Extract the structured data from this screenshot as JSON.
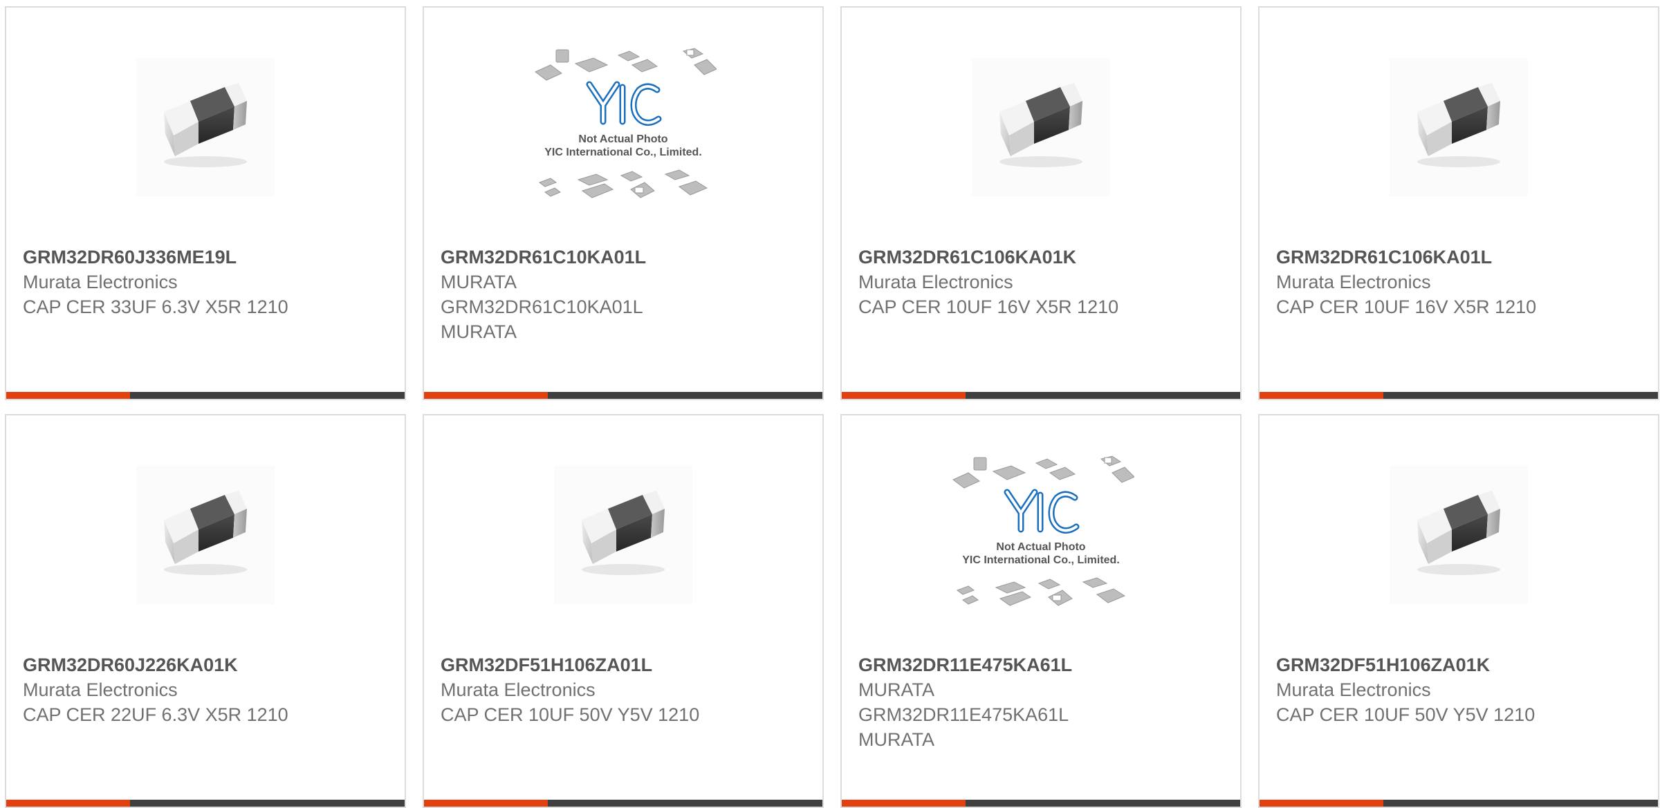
{
  "products": [
    {
      "part_number": "GRM32DR60J336ME19L",
      "lines": [
        "Murata Electronics",
        "CAP CER 33UF 6.3V X5R 1210"
      ],
      "photo": "capacitor-chip",
      "bar_progress": 0.31
    },
    {
      "part_number": "GRM32DR61C10KA01L",
      "lines": [
        "MURATA",
        "GRM32DR61C10KA01L",
        "MURATA"
      ],
      "photo": "placeholder-yic",
      "photo_text": {
        "notice": "Not Actual Photo",
        "company": "YIC International Co., Limited."
      },
      "bar_progress": 0.31
    },
    {
      "part_number": "GRM32DR61C106KA01K",
      "lines": [
        "Murata Electronics",
        "CAP CER 10UF 16V X5R 1210"
      ],
      "photo": "capacitor-chip",
      "bar_progress": 0.31
    },
    {
      "part_number": "GRM32DR61C106KA01L",
      "lines": [
        "Murata Electronics",
        "CAP CER 10UF 16V X5R 1210"
      ],
      "photo": "capacitor-chip",
      "bar_progress": 0.31
    },
    {
      "part_number": "GRM32DR60J226KA01K",
      "lines": [
        "Murata Electronics",
        "CAP CER 22UF 6.3V X5R 1210"
      ],
      "photo": "capacitor-chip",
      "bar_progress": 0.31
    },
    {
      "part_number": "GRM32DF51H106ZA01L",
      "lines": [
        "Murata Electronics",
        "CAP CER 10UF 50V Y5V 1210"
      ],
      "photo": "capacitor-chip",
      "bar_progress": 0.31
    },
    {
      "part_number": "GRM32DR11E475KA61L",
      "lines": [
        "MURATA",
        "GRM32DR11E475KA61L",
        "MURATA"
      ],
      "photo": "placeholder-yic",
      "photo_text": {
        "notice": "Not Actual Photo",
        "company": "YIC International Co., Limited."
      },
      "bar_progress": 0.31
    },
    {
      "part_number": "GRM32DF51H106ZA01K",
      "lines": [
        "Murata Electronics",
        "CAP CER 10UF 50V Y5V 1210"
      ],
      "photo": "capacitor-chip",
      "bar_progress": 0.31
    }
  ],
  "colors": {
    "accent": "#e2400f",
    "bar_dark": "#3f3f3f",
    "card_border": "#dcdcdc",
    "title_text": "#555555",
    "body_text": "#707070"
  }
}
